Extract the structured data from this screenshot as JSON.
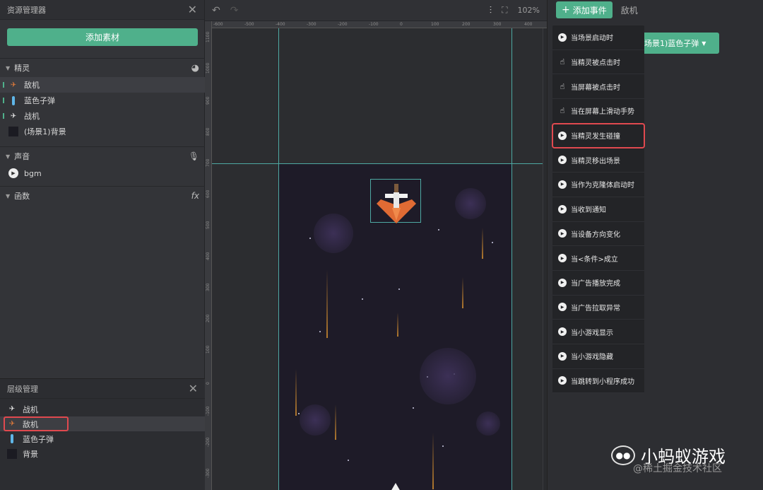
{
  "asset_panel": {
    "title": "资源管理器",
    "add_button": "添加素材",
    "sprites_section": "精灵",
    "sprites": [
      {
        "label": "敌机",
        "icon": "enemy-plane-icon"
      },
      {
        "label": "蓝色子弹",
        "icon": "blue-bullet-icon"
      },
      {
        "label": "战机",
        "icon": "fighter-plane-icon"
      },
      {
        "label": "(场景1)背景",
        "icon": "background-icon"
      }
    ],
    "sound_section": "声音",
    "sounds": [
      {
        "label": "bgm"
      }
    ],
    "function_section": "函数"
  },
  "layer_panel": {
    "title": "层级管理",
    "items": [
      {
        "label": "战机"
      },
      {
        "label": "敌机"
      },
      {
        "label": "蓝色子弹"
      },
      {
        "label": "背景"
      }
    ]
  },
  "canvas": {
    "zoom": "102%",
    "ruler_x": [
      "-600",
      "-500",
      "-400",
      "-300",
      "-200",
      "-100",
      "0",
      "100",
      "200",
      "300",
      "400"
    ],
    "ruler_y": [
      "1100",
      "1000",
      "900",
      "800",
      "700",
      "600",
      "500",
      "400",
      "300",
      "200",
      "100",
      "0",
      "-100",
      "-200",
      "-300"
    ]
  },
  "events": {
    "add_event_button": "添加事件",
    "tab_label": "敌机",
    "block_label": "场景1)蓝色子弹",
    "menu_items": [
      {
        "label": "当场景启动时",
        "icon": "play-icon"
      },
      {
        "label": "当精灵被点击时",
        "icon": "hand-icon"
      },
      {
        "label": "当屏幕被点击时",
        "icon": "hand-icon"
      },
      {
        "label": "当在屏幕上滑动手势",
        "icon": "hand-icon"
      },
      {
        "label": "当精灵发生碰撞",
        "icon": "play-icon"
      },
      {
        "label": "当精灵移出场景",
        "icon": "play-icon"
      },
      {
        "label": "当作为克隆体启动时",
        "icon": "play-icon"
      },
      {
        "label": "当收到通知",
        "icon": "play-icon"
      },
      {
        "label": "当设备方向变化",
        "icon": "play-icon"
      },
      {
        "label": "当<条件>成立",
        "icon": "play-icon"
      },
      {
        "label": "当广告播放完成",
        "icon": "play-icon"
      },
      {
        "label": "当广告拉取异常",
        "icon": "play-icon"
      },
      {
        "label": "当小游戏显示",
        "icon": "play-icon"
      },
      {
        "label": "当小游戏隐藏",
        "icon": "play-icon"
      },
      {
        "label": "当跳转到小程序成功",
        "icon": "play-icon"
      }
    ]
  },
  "watermark": {
    "title": "小蚂蚁游戏",
    "subtitle": "@稀土掘金技术社区"
  },
  "colors": {
    "accent": "#4fb08b",
    "highlight": "#e0494f",
    "guide": "#4ea9a3"
  }
}
